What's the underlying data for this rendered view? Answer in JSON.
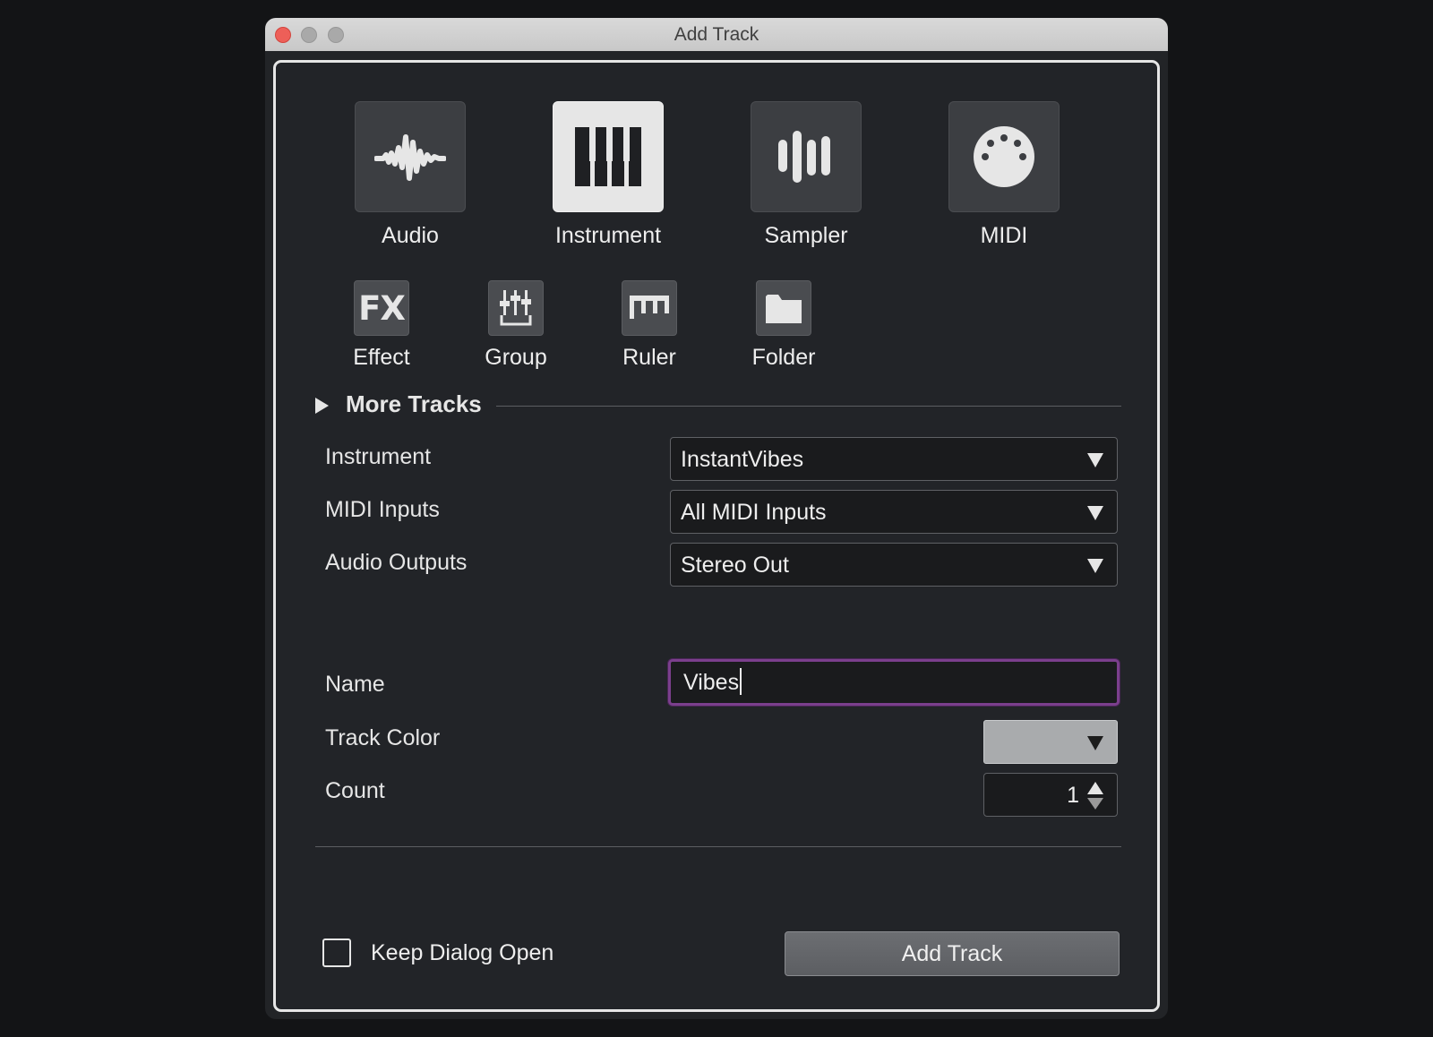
{
  "window": {
    "title": "Add Track"
  },
  "track_types": [
    {
      "label": "Audio",
      "icon": "waveform-icon",
      "selected": false
    },
    {
      "label": "Instrument",
      "icon": "piano-keys-icon",
      "selected": true
    },
    {
      "label": "Sampler",
      "icon": "sampler-bars-icon",
      "selected": false
    },
    {
      "label": "MIDI",
      "icon": "midi-connector-icon",
      "selected": false
    }
  ],
  "small_types": [
    {
      "label": "Effect",
      "icon": "fx-icon",
      "icon_text": "FX"
    },
    {
      "label": "Group",
      "icon": "group-faders-icon"
    },
    {
      "label": "Ruler",
      "icon": "ruler-icon"
    },
    {
      "label": "Folder",
      "icon": "folder-icon"
    }
  ],
  "more_tracks": {
    "label": "More Tracks",
    "expanded": false
  },
  "fields": {
    "instrument": {
      "label": "Instrument",
      "value": "InstantVibes"
    },
    "midi_inputs": {
      "label": "MIDI Inputs",
      "value": "All MIDI Inputs"
    },
    "audio_outputs": {
      "label": "Audio Outputs",
      "value": "Stereo Out"
    },
    "name": {
      "label": "Name",
      "value": "Vibes"
    },
    "track_color": {
      "label": "Track Color",
      "value": "#a9abad"
    },
    "count": {
      "label": "Count",
      "value": "1"
    }
  },
  "footer": {
    "keep_open_label": "Keep Dialog Open",
    "keep_open_checked": false,
    "add_button_label": "Add Track"
  },
  "colors": {
    "accent_focus": "#7b3f8d",
    "close_button": "#ed5f58",
    "background": "#222428"
  }
}
